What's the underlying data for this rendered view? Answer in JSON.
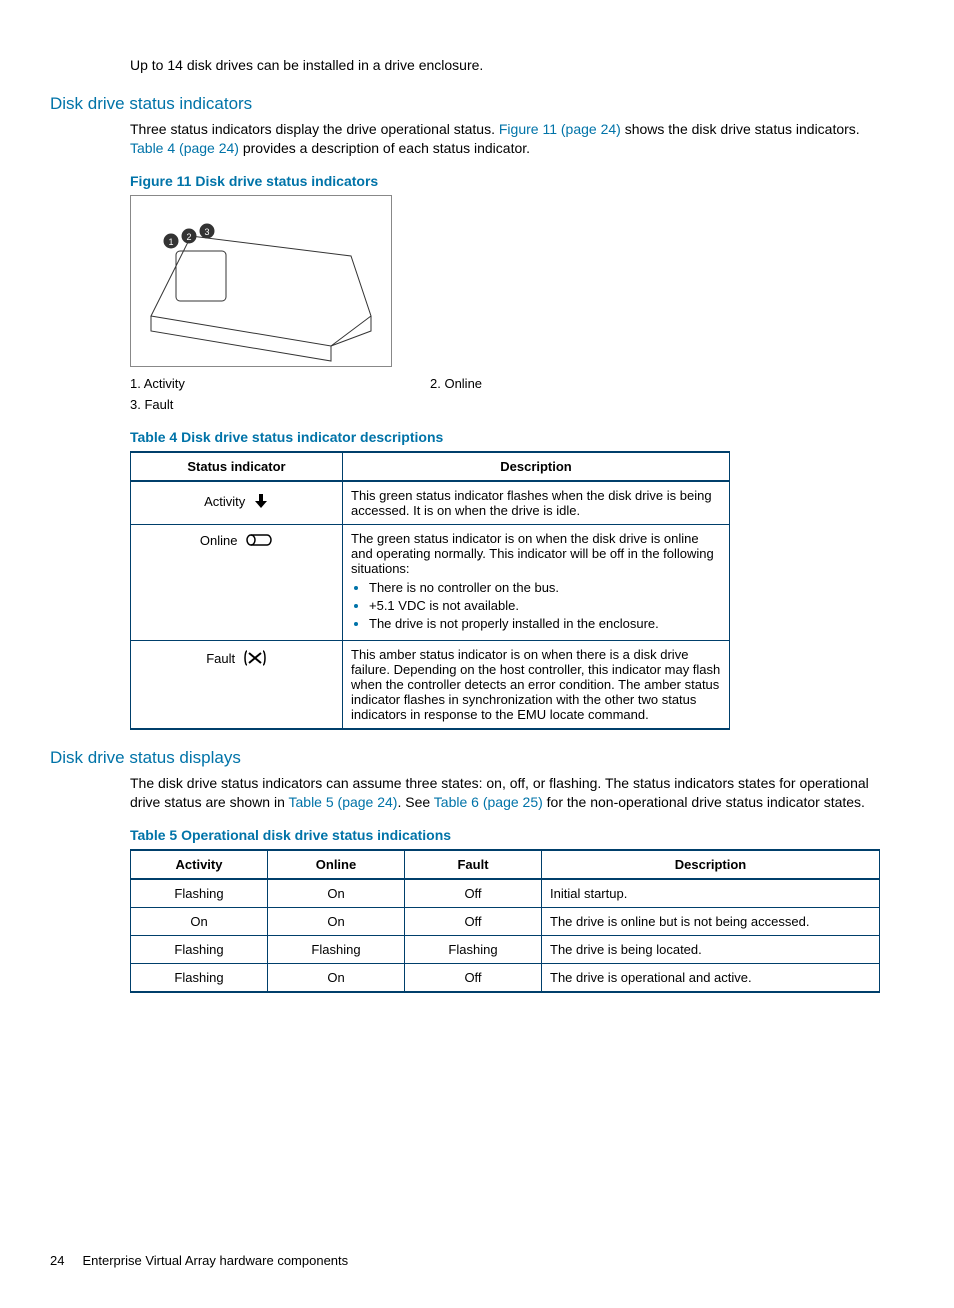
{
  "intro": "Up to 14 disk drives can be installed in a drive enclosure.",
  "sec1": {
    "title": "Disk drive status indicators",
    "para_a": "Three status indicators display the drive operational status. ",
    "link1": "Figure 11 (page 24)",
    "para_b": " shows the disk drive status indicators. ",
    "link2": "Table 4 (page 24)",
    "para_c": " provides a description of each status indicator."
  },
  "fig11": {
    "caption": "Figure 11 Disk drive status indicators",
    "items": [
      "1. Activity",
      "2. Online",
      "3. Fault"
    ]
  },
  "table4": {
    "caption": "Table 4 Disk drive status indicator descriptions",
    "head": [
      "Status indicator",
      "Description"
    ],
    "rows": [
      {
        "name": "Activity",
        "desc": "This green status indicator flashes when the disk drive is being accessed. It is on when the drive is idle."
      },
      {
        "name": "Online",
        "desc": "The green status indicator is on when the disk drive is online and operating normally. This indicator will be off in the following situations:",
        "bullets": [
          "There is no controller on the bus.",
          "+5.1 VDC is not available.",
          "The drive is not properly installed in the enclosure."
        ]
      },
      {
        "name": "Fault",
        "desc": "This amber status indicator is on when there is a disk drive failure. Depending on the host controller, this indicator may flash when the controller detects an error condition. The amber status indicator flashes in synchronization with the other two status indicators in response to the EMU locate command."
      }
    ]
  },
  "sec2": {
    "title": "Disk drive status displays",
    "para_a": "The disk drive status indicators can assume three states: on, off, or flashing. The status indicators states for operational drive status are shown in ",
    "link1": "Table 5 (page 24)",
    "mid": ". See ",
    "link2": "Table 6 (page 25)",
    "para_b": " for the non-operational drive status indicator states."
  },
  "table5": {
    "caption": "Table 5 Operational disk drive status indications",
    "head": [
      "Activity",
      "Online",
      "Fault",
      "Description"
    ],
    "rows": [
      [
        "Flashing",
        "On",
        "Off",
        "Initial startup."
      ],
      [
        "On",
        "On",
        "Off",
        "The drive is online but is not being accessed."
      ],
      [
        "Flashing",
        "Flashing",
        "Flashing",
        "The drive is being located."
      ],
      [
        "Flashing",
        "On",
        "Off",
        "The drive is operational and active."
      ]
    ]
  },
  "footer": {
    "page": "24",
    "title": "Enterprise Virtual Array hardware components"
  }
}
